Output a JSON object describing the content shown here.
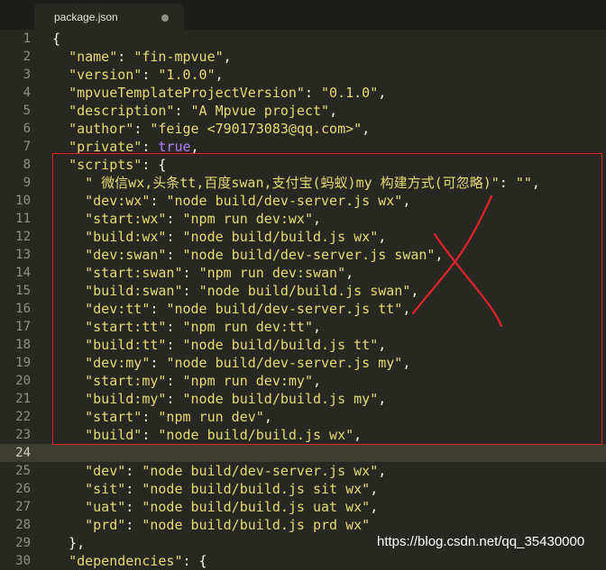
{
  "tab": {
    "filename": "package.json"
  },
  "lines": [
    {
      "num": "1",
      "code": "{"
    },
    {
      "num": "2",
      "code": "  \"name\": \"fin-mpvue\","
    },
    {
      "num": "3",
      "code": "  \"version\": \"1.0.0\","
    },
    {
      "num": "4",
      "code": "  \"mpvueTemplateProjectVersion\": \"0.1.0\","
    },
    {
      "num": "5",
      "code": "  \"description\": \"A Mpvue project\","
    },
    {
      "num": "6",
      "code": "  \"author\": \"feige <790173083@qq.com>\","
    },
    {
      "num": "7",
      "code": "  \"private\": true,"
    },
    {
      "num": "8",
      "code": "  \"scripts\": {"
    },
    {
      "num": "9",
      "code": "    \" 微信wx,头条tt,百度swan,支付宝(蚂蚁)my 构建方式(可忽略)\": \"\","
    },
    {
      "num": "10",
      "code": "    \"dev:wx\": \"node build/dev-server.js wx\","
    },
    {
      "num": "11",
      "code": "    \"start:wx\": \"npm run dev:wx\","
    },
    {
      "num": "12",
      "code": "    \"build:wx\": \"node build/build.js wx\","
    },
    {
      "num": "13",
      "code": "    \"dev:swan\": \"node build/dev-server.js swan\","
    },
    {
      "num": "14",
      "code": "    \"start:swan\": \"npm run dev:swan\","
    },
    {
      "num": "15",
      "code": "    \"build:swan\": \"node build/build.js swan\","
    },
    {
      "num": "16",
      "code": "    \"dev:tt\": \"node build/dev-server.js tt\","
    },
    {
      "num": "17",
      "code": "    \"start:tt\": \"npm run dev:tt\","
    },
    {
      "num": "18",
      "code": "    \"build:tt\": \"node build/build.js tt\","
    },
    {
      "num": "19",
      "code": "    \"dev:my\": \"node build/dev-server.js my\","
    },
    {
      "num": "20",
      "code": "    \"start:my\": \"npm run dev:my\","
    },
    {
      "num": "21",
      "code": "    \"build:my\": \"node build/build.js my\","
    },
    {
      "num": "22",
      "code": "    \"start\": \"npm run dev\","
    },
    {
      "num": "23",
      "code": "    \"build\": \"node build/build.js wx\","
    },
    {
      "num": "24",
      "code": ""
    },
    {
      "num": "25",
      "code": "    \"dev\": \"node build/dev-server.js wx\","
    },
    {
      "num": "26",
      "code": "    \"sit\": \"node build/build.js sit wx\","
    },
    {
      "num": "27",
      "code": "    \"uat\": \"node build/build.js uat wx\","
    },
    {
      "num": "28",
      "code": "    \"prd\": \"node build/build.js prd wx\""
    },
    {
      "num": "29",
      "code": "  },"
    },
    {
      "num": "30",
      "code": "  \"dependencies\": {"
    }
  ],
  "current_line": "24",
  "watermark": "https://blog.csdn.net/qq_35430000",
  "colors": {
    "background": "#272822",
    "string": "#e6db74",
    "keyword": "#ae81ff",
    "annotation": "#e8222b"
  }
}
